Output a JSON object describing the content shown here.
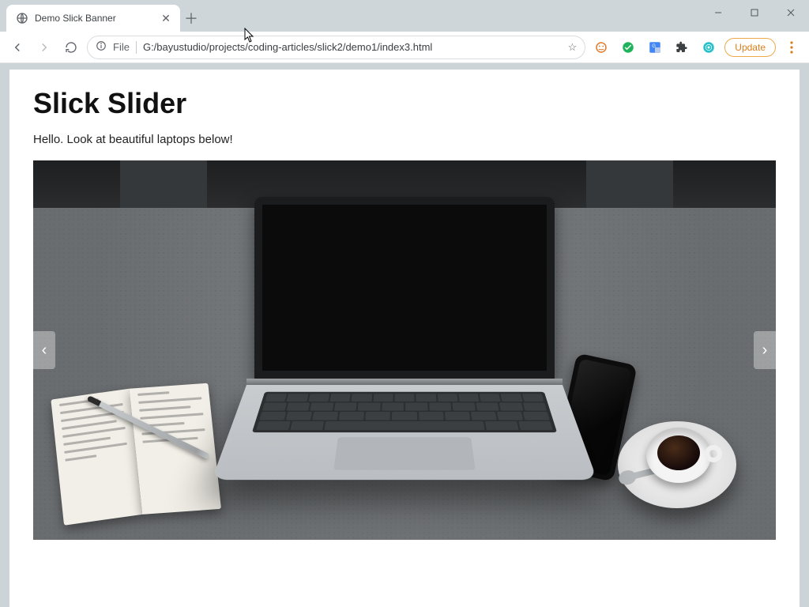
{
  "browser": {
    "tab_title": "Demo Slick Banner",
    "file_label": "File",
    "url": "G:/bayustudio/projects/coding-articles/slick2/demo1/index3.html",
    "update_label": "Update"
  },
  "page": {
    "heading": "Slick Slider",
    "intro": "Hello. Look at beautiful laptops below!"
  },
  "slider": {
    "current_image_alt": "Laptop on grey desk with notebook, phone and coffee"
  }
}
